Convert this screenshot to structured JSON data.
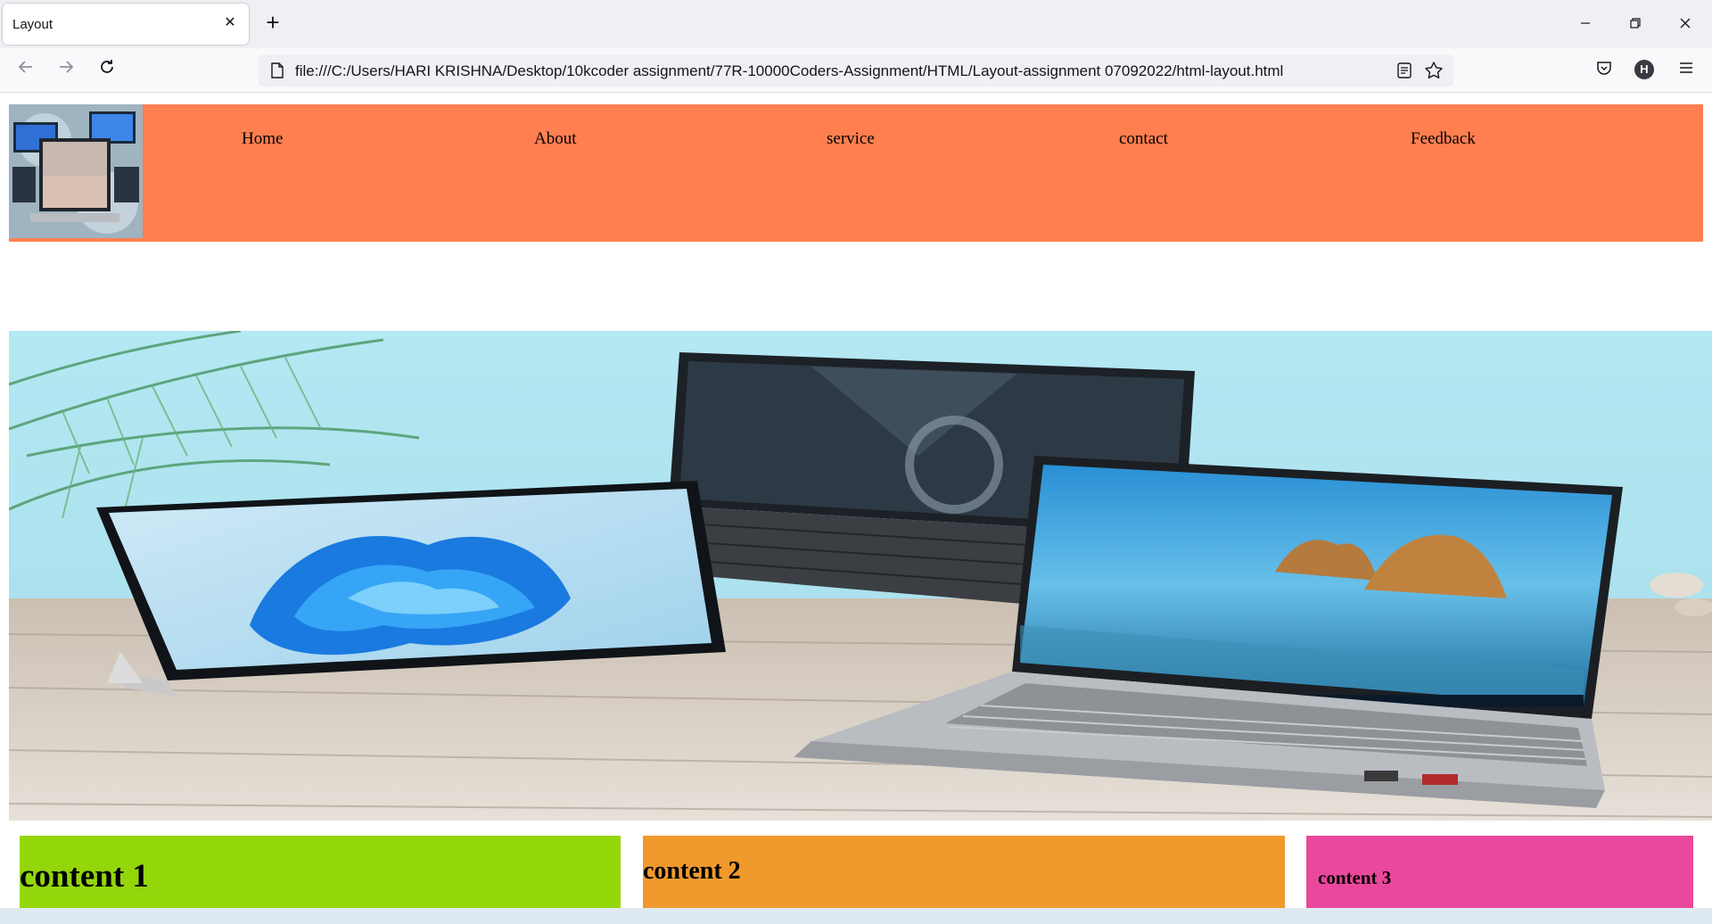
{
  "browser": {
    "tab_title": "Layout",
    "tab_close_glyph": "✕",
    "new_tab_glyph": "+",
    "url": "file:///C:/Users/HARI KRISHNA/Desktop/10kcoder assignment/77R-10000Coders-Assignment/HTML/Layout-assignment 07092022/html-layout.html",
    "profile_initial": "H",
    "icons": [
      "back-icon",
      "forward-icon",
      "reload-icon",
      "page-icon",
      "reader-view-icon",
      "bookmark-star-icon",
      "pocket-icon",
      "menu-icon",
      "minimize-icon",
      "restore-icon",
      "close-icon"
    ]
  },
  "site": {
    "nav": [
      "Home",
      "About",
      "service",
      "contact",
      "Feedback"
    ],
    "colors": {
      "header": "#ff7f50",
      "content1": "#93d60a",
      "content2": "#f09a2d",
      "content3": "#ea489c"
    },
    "contents": [
      {
        "label": "content 1"
      },
      {
        "label": "content 2"
      },
      {
        "label": "content 3"
      }
    ]
  }
}
